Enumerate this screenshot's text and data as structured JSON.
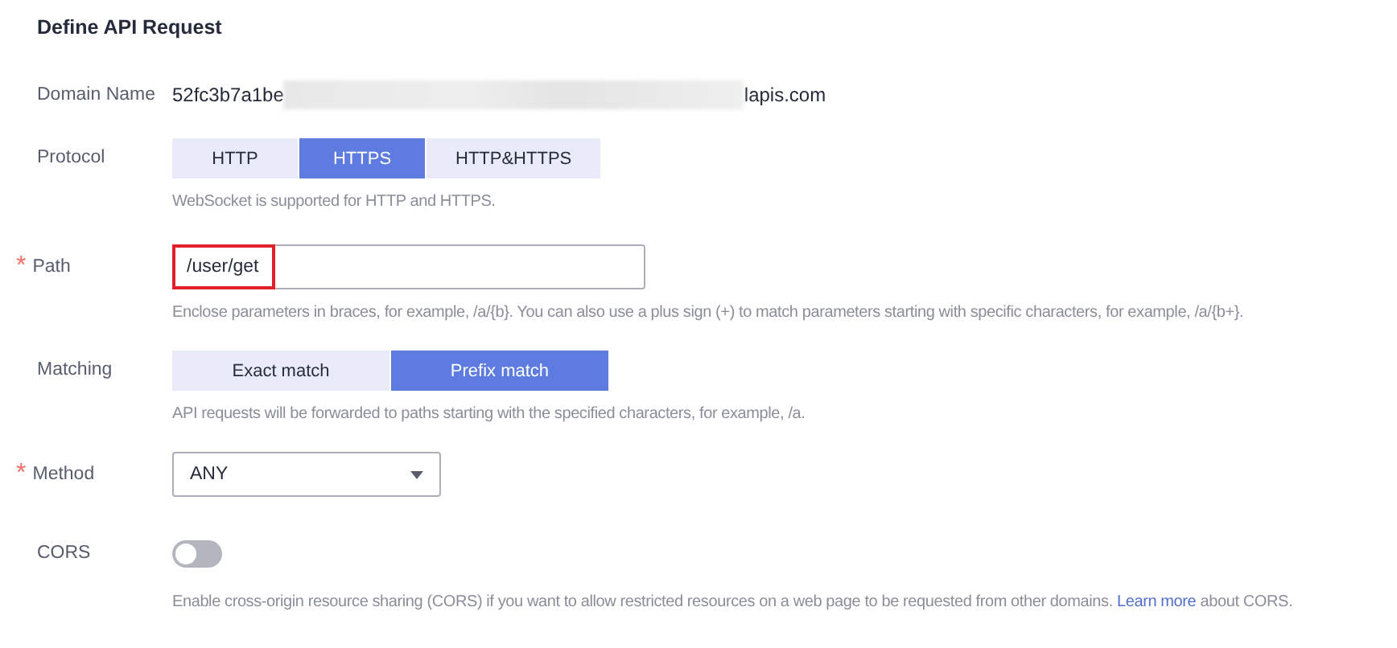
{
  "title": "Define API Request",
  "fields": [
    {
      "kind": "domain",
      "label": "Domain Name",
      "value_start": "52fc3b7a1be",
      "value_end": "lapis.com",
      "redacted": true
    },
    {
      "kind": "segmented",
      "label": "Protocol",
      "options": [
        {
          "label": "HTTP",
          "selected": false
        },
        {
          "label": "HTTPS",
          "selected": true
        },
        {
          "label": "HTTP&HTTPS",
          "selected": false
        }
      ],
      "hint": "WebSocket is supported for HTTP and HTTPS."
    },
    {
      "kind": "input",
      "label": "Path",
      "required_mark": "*",
      "value": "/user/get",
      "highlighted": true,
      "hint": "Enclose parameters in braces, for example, /a/{b}. You can also use a plus sign (+) to match parameters starting with specific characters, for example, /a/{b+}."
    },
    {
      "kind": "segmented",
      "label": "Matching",
      "options": [
        {
          "label": "Exact match",
          "selected": false
        },
        {
          "label": "Prefix match",
          "selected": true
        }
      ],
      "hint": "API requests will be forwarded to paths starting with the specified characters, for example, /a."
    },
    {
      "kind": "select",
      "label": "Method",
      "required_mark": "*",
      "value": "ANY"
    },
    {
      "kind": "toggle",
      "label": "CORS",
      "on": false,
      "hint": "Enable cross-origin resource sharing (CORS) if you want to allow restricted resources on a web page to be requested from other domains.",
      "link": "Learn more",
      "hint_end": "about CORS."
    }
  ]
}
